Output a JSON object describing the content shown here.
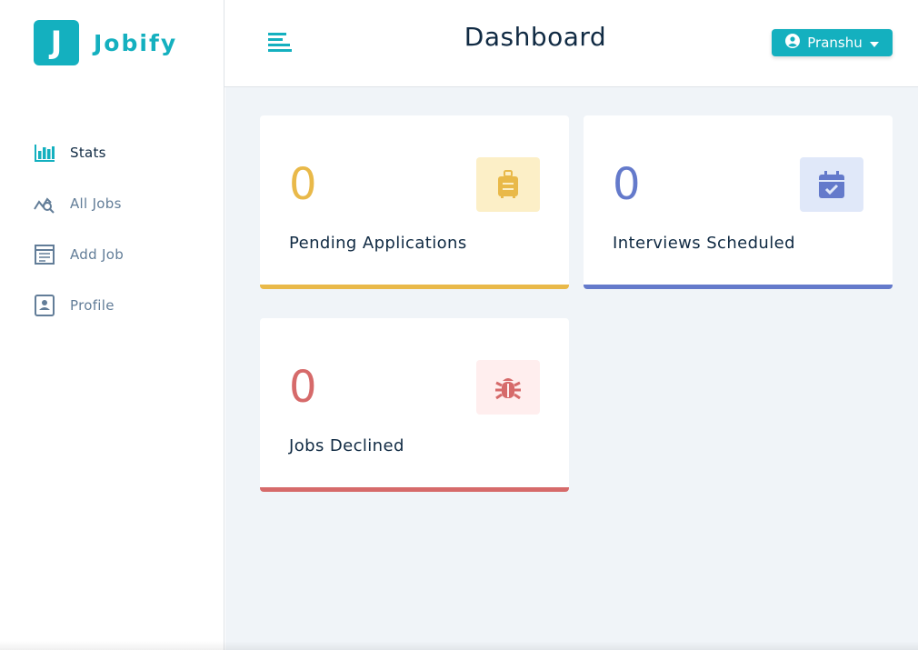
{
  "app": {
    "logo_letter": "J",
    "name": "Jobify"
  },
  "header": {
    "title": "Dashboard",
    "user_name": "Pranshu"
  },
  "sidebar": {
    "items": [
      {
        "label": "Stats",
        "icon": "bar-chart-icon",
        "active": true
      },
      {
        "label": "All Jobs",
        "icon": "query-stats-icon",
        "active": false
      },
      {
        "label": "Add Job",
        "icon": "form-icon",
        "active": false
      },
      {
        "label": "Profile",
        "icon": "id-card-icon",
        "active": false
      }
    ]
  },
  "stats": [
    {
      "count": "0",
      "label": "Pending Applications",
      "icon": "suitcase-icon",
      "color": "#e9b949",
      "bg": "#fcefc7"
    },
    {
      "count": "0",
      "label": "Interviews Scheduled",
      "icon": "calendar-check-icon",
      "color": "#647acb",
      "bg": "#e0e8f9"
    },
    {
      "count": "0",
      "label": "Jobs Declined",
      "icon": "bug-icon",
      "color": "#d66a6a",
      "bg": "#ffeeee"
    }
  ],
  "colors": {
    "primary": "#14b0bf",
    "background": "#f0f4f8",
    "text": "#102a43",
    "muted": "#627d98"
  }
}
